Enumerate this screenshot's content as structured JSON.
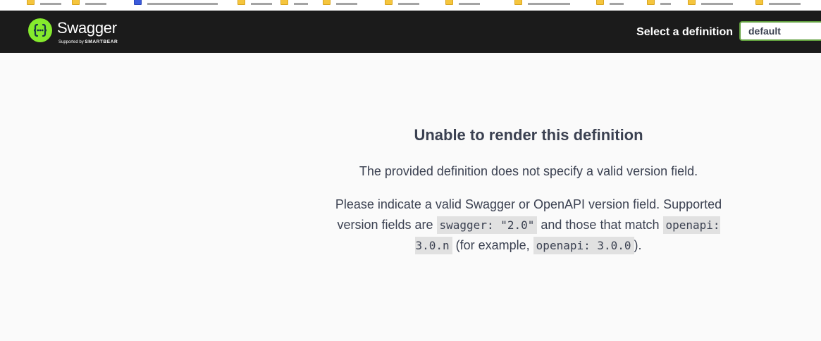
{
  "header": {
    "brand_name": "Swagger",
    "brand_sub_prefix": "Supported by",
    "brand_sub_company": "SMARTBEAR",
    "select_label": "Select a definition",
    "select_value": "default",
    "accent_color": "#85ea2d",
    "bar_color": "#1b1b1b"
  },
  "error": {
    "title": "Unable to render this definition",
    "line1": "The provided definition does not specify a valid version field.",
    "line2_a": "Please indicate a valid Swagger or OpenAPI version field. Supported version fields are ",
    "code1": "swagger: \"2.0\"",
    "line2_b": " and those that match ",
    "code2": "openapi: 3.0.n",
    "line2_c": " (for example, ",
    "code3": "openapi: 3.0.0",
    "line2_d": ")."
  }
}
